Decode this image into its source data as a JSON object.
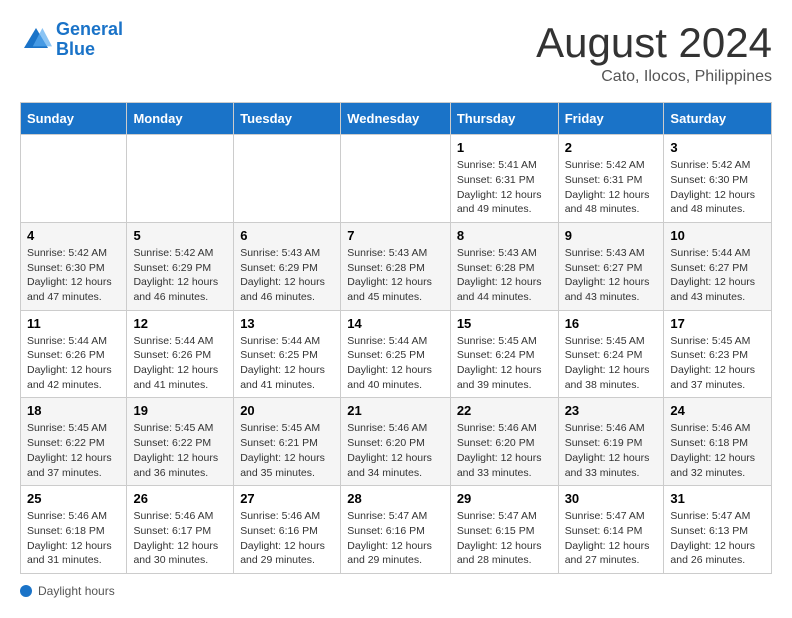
{
  "header": {
    "logo_line1": "General",
    "logo_line2": "Blue",
    "title": "August 2024",
    "subtitle": "Cato, Ilocos, Philippines"
  },
  "days_of_week": [
    "Sunday",
    "Monday",
    "Tuesday",
    "Wednesday",
    "Thursday",
    "Friday",
    "Saturday"
  ],
  "weeks": [
    [
      {
        "day": "",
        "text": ""
      },
      {
        "day": "",
        "text": ""
      },
      {
        "day": "",
        "text": ""
      },
      {
        "day": "",
        "text": ""
      },
      {
        "day": "1",
        "text": "Sunrise: 5:41 AM\nSunset: 6:31 PM\nDaylight: 12 hours and 49 minutes."
      },
      {
        "day": "2",
        "text": "Sunrise: 5:42 AM\nSunset: 6:31 PM\nDaylight: 12 hours and 48 minutes."
      },
      {
        "day": "3",
        "text": "Sunrise: 5:42 AM\nSunset: 6:30 PM\nDaylight: 12 hours and 48 minutes."
      }
    ],
    [
      {
        "day": "4",
        "text": "Sunrise: 5:42 AM\nSunset: 6:30 PM\nDaylight: 12 hours and 47 minutes."
      },
      {
        "day": "5",
        "text": "Sunrise: 5:42 AM\nSunset: 6:29 PM\nDaylight: 12 hours and 46 minutes."
      },
      {
        "day": "6",
        "text": "Sunrise: 5:43 AM\nSunset: 6:29 PM\nDaylight: 12 hours and 46 minutes."
      },
      {
        "day": "7",
        "text": "Sunrise: 5:43 AM\nSunset: 6:28 PM\nDaylight: 12 hours and 45 minutes."
      },
      {
        "day": "8",
        "text": "Sunrise: 5:43 AM\nSunset: 6:28 PM\nDaylight: 12 hours and 44 minutes."
      },
      {
        "day": "9",
        "text": "Sunrise: 5:43 AM\nSunset: 6:27 PM\nDaylight: 12 hours and 43 minutes."
      },
      {
        "day": "10",
        "text": "Sunrise: 5:44 AM\nSunset: 6:27 PM\nDaylight: 12 hours and 43 minutes."
      }
    ],
    [
      {
        "day": "11",
        "text": "Sunrise: 5:44 AM\nSunset: 6:26 PM\nDaylight: 12 hours and 42 minutes."
      },
      {
        "day": "12",
        "text": "Sunrise: 5:44 AM\nSunset: 6:26 PM\nDaylight: 12 hours and 41 minutes."
      },
      {
        "day": "13",
        "text": "Sunrise: 5:44 AM\nSunset: 6:25 PM\nDaylight: 12 hours and 41 minutes."
      },
      {
        "day": "14",
        "text": "Sunrise: 5:44 AM\nSunset: 6:25 PM\nDaylight: 12 hours and 40 minutes."
      },
      {
        "day": "15",
        "text": "Sunrise: 5:45 AM\nSunset: 6:24 PM\nDaylight: 12 hours and 39 minutes."
      },
      {
        "day": "16",
        "text": "Sunrise: 5:45 AM\nSunset: 6:24 PM\nDaylight: 12 hours and 38 minutes."
      },
      {
        "day": "17",
        "text": "Sunrise: 5:45 AM\nSunset: 6:23 PM\nDaylight: 12 hours and 37 minutes."
      }
    ],
    [
      {
        "day": "18",
        "text": "Sunrise: 5:45 AM\nSunset: 6:22 PM\nDaylight: 12 hours and 37 minutes."
      },
      {
        "day": "19",
        "text": "Sunrise: 5:45 AM\nSunset: 6:22 PM\nDaylight: 12 hours and 36 minutes."
      },
      {
        "day": "20",
        "text": "Sunrise: 5:45 AM\nSunset: 6:21 PM\nDaylight: 12 hours and 35 minutes."
      },
      {
        "day": "21",
        "text": "Sunrise: 5:46 AM\nSunset: 6:20 PM\nDaylight: 12 hours and 34 minutes."
      },
      {
        "day": "22",
        "text": "Sunrise: 5:46 AM\nSunset: 6:20 PM\nDaylight: 12 hours and 33 minutes."
      },
      {
        "day": "23",
        "text": "Sunrise: 5:46 AM\nSunset: 6:19 PM\nDaylight: 12 hours and 33 minutes."
      },
      {
        "day": "24",
        "text": "Sunrise: 5:46 AM\nSunset: 6:18 PM\nDaylight: 12 hours and 32 minutes."
      }
    ],
    [
      {
        "day": "25",
        "text": "Sunrise: 5:46 AM\nSunset: 6:18 PM\nDaylight: 12 hours and 31 minutes."
      },
      {
        "day": "26",
        "text": "Sunrise: 5:46 AM\nSunset: 6:17 PM\nDaylight: 12 hours and 30 minutes."
      },
      {
        "day": "27",
        "text": "Sunrise: 5:46 AM\nSunset: 6:16 PM\nDaylight: 12 hours and 29 minutes."
      },
      {
        "day": "28",
        "text": "Sunrise: 5:47 AM\nSunset: 6:16 PM\nDaylight: 12 hours and 29 minutes."
      },
      {
        "day": "29",
        "text": "Sunrise: 5:47 AM\nSunset: 6:15 PM\nDaylight: 12 hours and 28 minutes."
      },
      {
        "day": "30",
        "text": "Sunrise: 5:47 AM\nSunset: 6:14 PM\nDaylight: 12 hours and 27 minutes."
      },
      {
        "day": "31",
        "text": "Sunrise: 5:47 AM\nSunset: 6:13 PM\nDaylight: 12 hours and 26 minutes."
      }
    ]
  ],
  "footer": {
    "label": "Daylight hours"
  }
}
